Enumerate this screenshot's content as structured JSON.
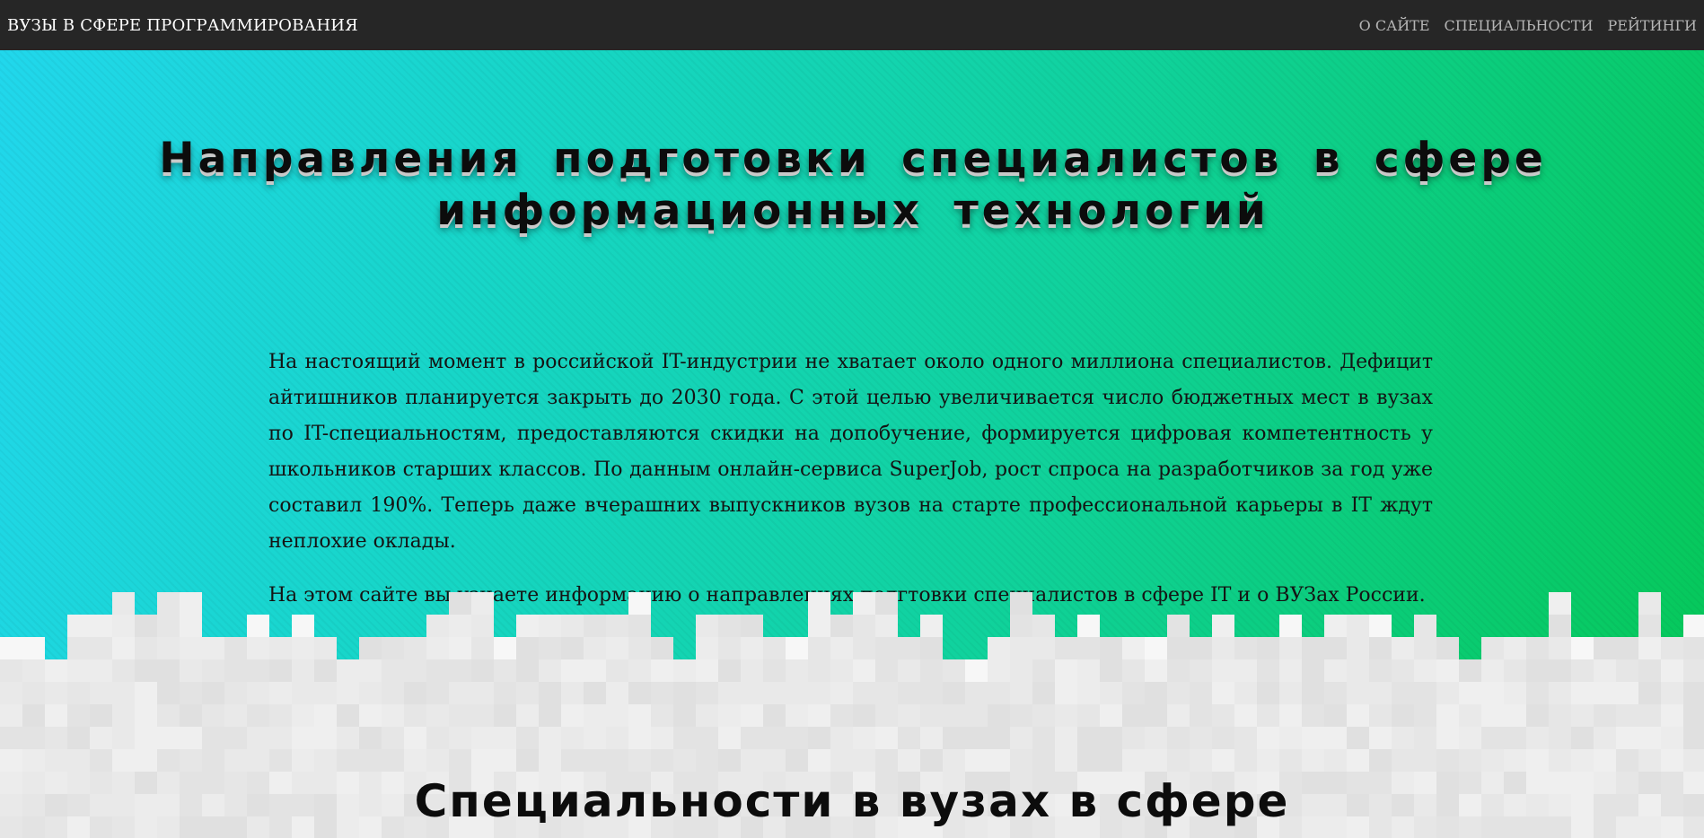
{
  "navbar": {
    "brand": "ВУЗЫ В СФЕРЕ ПРОГРАММИРОВАНИЯ",
    "links": [
      "О САЙТЕ",
      "СПЕЦИАЛЬНОСТИ",
      "РЕЙТИНГИ"
    ]
  },
  "hero": {
    "title_line1": "Направления подготовки специалистов в сфере",
    "title_line2": "информационных технологий",
    "paragraph1": "На настоящий момент в российской IT-индустрии не хватает около одного миллиона специалистов. Дефицит айтишников планируется закрыть до 2030 года. С этой целью увеличивается число бюджетных мест в вузах по IT-специальностям, предоставляются скидки на допобучение, формируется цифровая компетентность у школьников старших классов. По данным онлайн-сервиса SuperJob, рост спроса на разработчиков за год уже составил 190%. Теперь даже вчерашних выпускников вузов на старте профессиональной карьеры в IT ждут неплохие оклады.",
    "paragraph2": "На этом сайте вы узнаете информацию о направлениях подгтовки специалистов в сфере IT и о ВУЗах России."
  },
  "section2": {
    "title": "Специальности в вузах в сфере"
  },
  "colors": {
    "navbar_bg": "#262626",
    "gradient_start": "#21d7ec",
    "gradient_end": "#06c85a",
    "pixel_band": "#e6e6e6"
  }
}
